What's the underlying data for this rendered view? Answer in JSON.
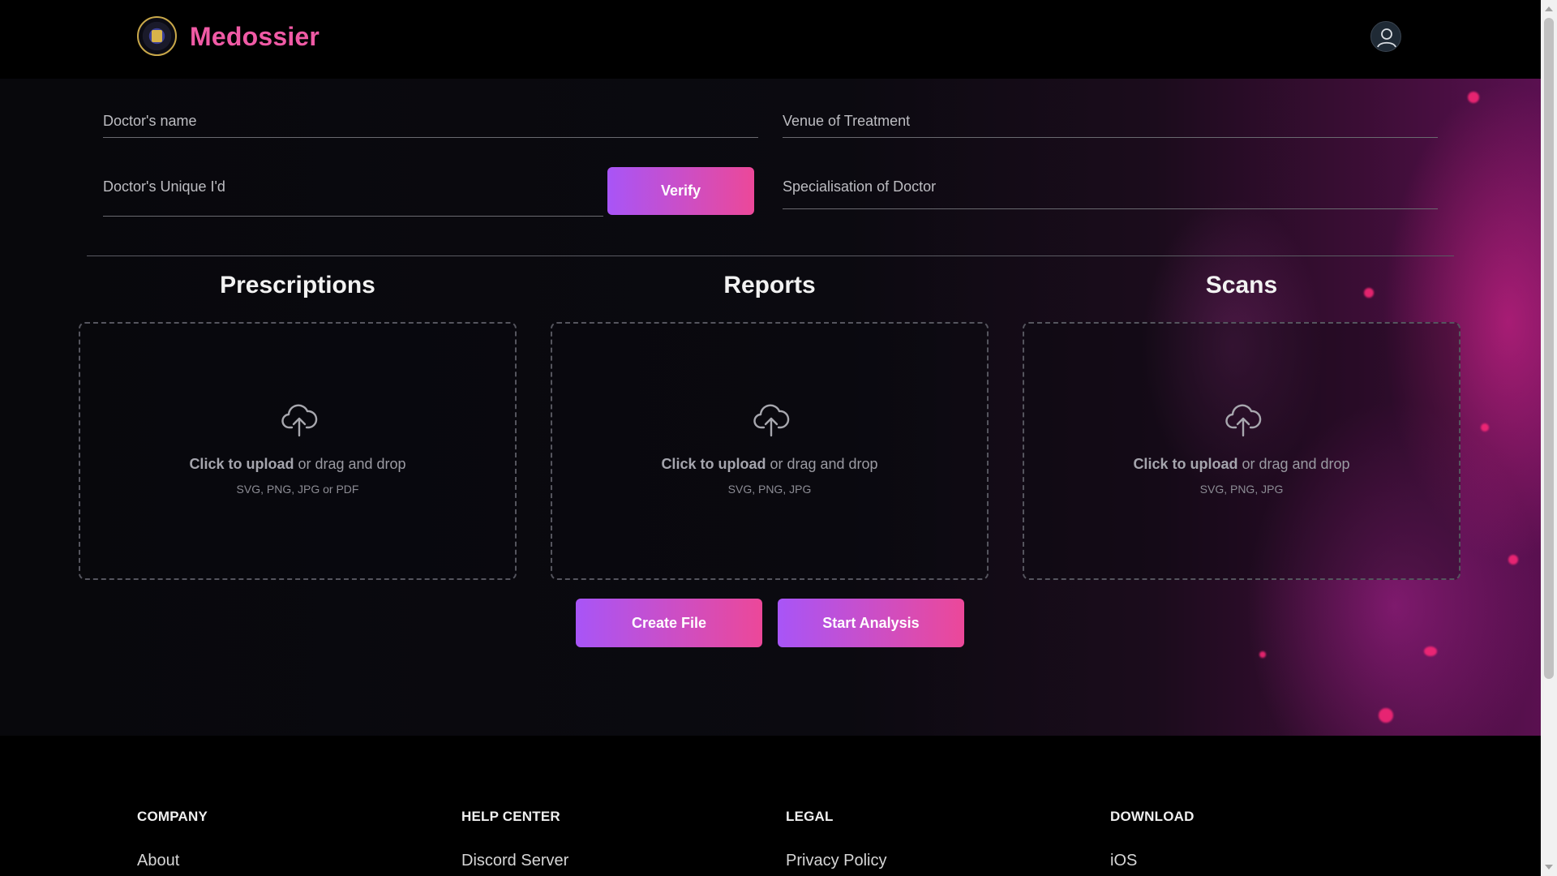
{
  "header": {
    "brand": "Medossier",
    "logo_icon": "medical-seal-logo",
    "avatar_icon": "user-avatar-icon"
  },
  "form": {
    "doctor_name_placeholder": "Doctor's name",
    "venue_placeholder": "Venue of Treatment",
    "doctor_id_placeholder": "Doctor's Unique I'd",
    "verify_label": "Verify",
    "specialisation_placeholder": "Specialisation of Doctor"
  },
  "uploads": [
    {
      "title": "Prescriptions",
      "action": "Click to upload",
      "rest": " or drag and drop",
      "formats": "SVG, PNG, JPG or PDF"
    },
    {
      "title": "Reports",
      "action": "Click to upload",
      "rest": " or drag and drop",
      "formats": "SVG, PNG, JPG"
    },
    {
      "title": "Scans",
      "action": "Click to upload",
      "rest": " or drag and drop",
      "formats": "SVG, PNG, JPG"
    }
  ],
  "actions": {
    "create_file_label": "Create File",
    "start_analysis_label": "Start Analysis"
  },
  "footer": {
    "columns": [
      {
        "heading": "COMPANY",
        "link": "About"
      },
      {
        "heading": "HELP CENTER",
        "link": "Discord Server"
      },
      {
        "heading": "LEGAL",
        "link": "Privacy Policy"
      },
      {
        "heading": "DOWNLOAD",
        "link": "iOS"
      }
    ]
  },
  "colors": {
    "brand": "#f05aa5",
    "gradient_start": "#a855f7",
    "gradient_end": "#ec4899",
    "background": "#000000"
  }
}
